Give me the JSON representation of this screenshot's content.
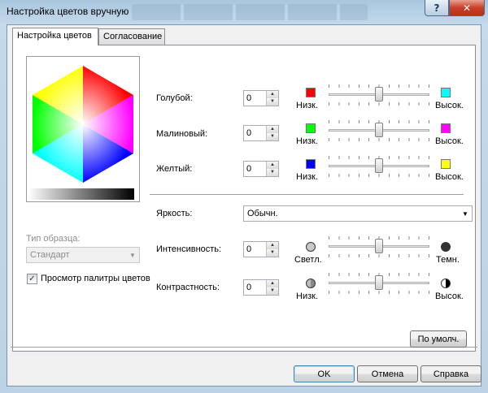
{
  "window": {
    "title": "Настройка цветов вручную",
    "help_label": "?",
    "close_label": "✕"
  },
  "tabs": [
    {
      "label": "Настройка цветов",
      "active": true
    },
    {
      "label": "Согласование",
      "active": false
    }
  ],
  "sample": {
    "type_label": "Тип образца:",
    "type_value": "Стандарт",
    "palette_checkbox_label": "Просмотр палитры цветов",
    "palette_checked": true
  },
  "color_rows": [
    {
      "label": "Голубой:",
      "value": "0",
      "low_label": "Низк.",
      "high_label": "Высок.",
      "low_color": "#ff0000",
      "high_color": "#00ffff",
      "level": 0.5
    },
    {
      "label": "Малиновый:",
      "value": "0",
      "low_label": "Низк.",
      "high_label": "Высок.",
      "low_color": "#00ff00",
      "high_color": "#ff00ff",
      "level": 0.5
    },
    {
      "label": "Желтый:",
      "value": "0",
      "low_label": "Низк.",
      "high_label": "Высок.",
      "low_color": "#0000ff",
      "high_color": "#ffff00",
      "level": 0.5
    }
  ],
  "brightness": {
    "label": "Яркость:",
    "value": "Обычн."
  },
  "intensity": {
    "label": "Интенсивность:",
    "value": "0",
    "low_label": "Светл.",
    "high_label": "Темн.",
    "level": 0.5
  },
  "contrast": {
    "label": "Контрастность:",
    "value": "0",
    "low_label": "Низк.",
    "high_label": "Высок.",
    "level": 0.5
  },
  "buttons": {
    "defaults": "По умолч.",
    "ok": "OK",
    "cancel": "Отмена",
    "help": "Справка"
  }
}
